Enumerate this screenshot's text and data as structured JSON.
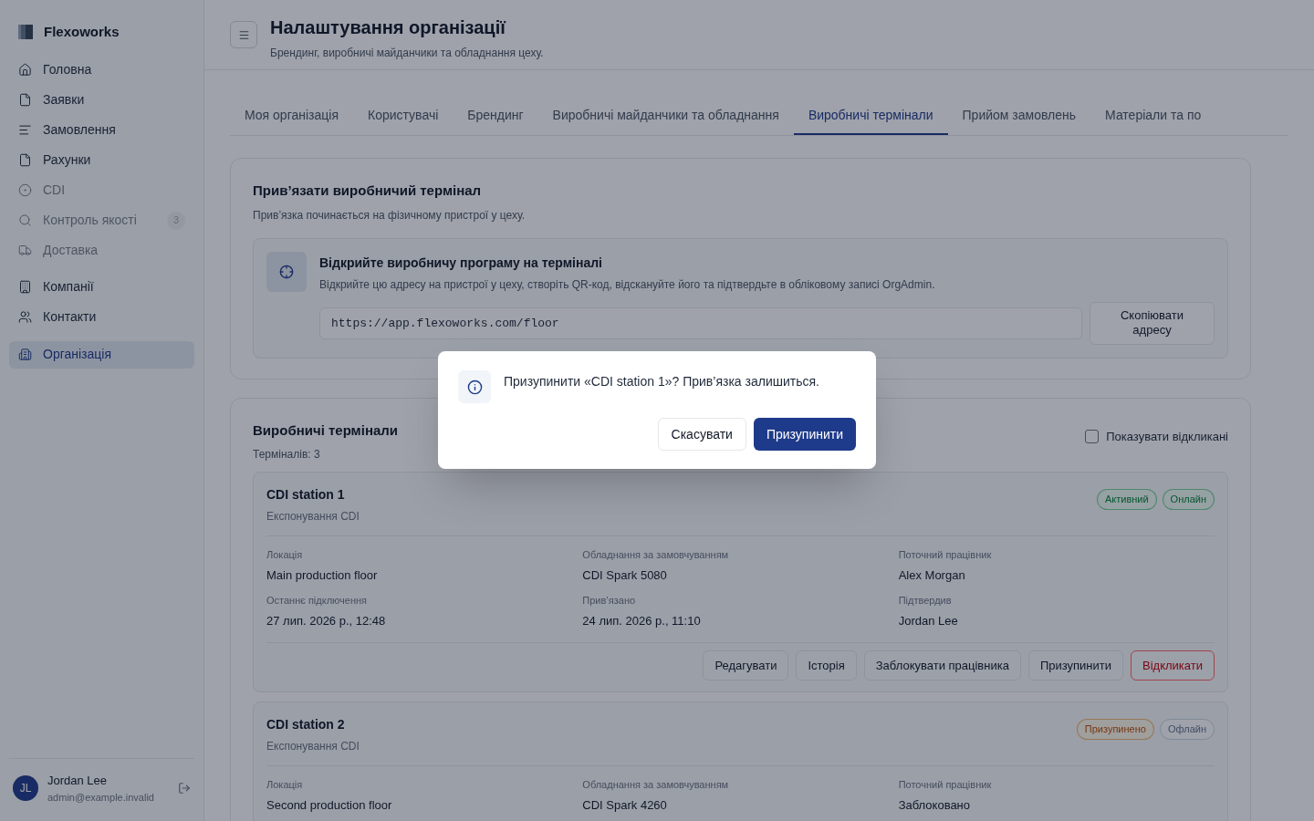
{
  "sidebar": {
    "brand": "Flexoworks",
    "groups": [
      [
        {
          "label": "Головна",
          "muted": false,
          "selected": false
        },
        {
          "label": "Заявки",
          "muted": false,
          "selected": false
        },
        {
          "label": "Замовлення",
          "muted": false,
          "selected": false
        },
        {
          "label": "Рахунки",
          "muted": false,
          "selected": false
        },
        {
          "label": "CDI",
          "muted": true,
          "selected": false
        },
        {
          "label": "Контроль якості",
          "muted": true,
          "selected": false,
          "badge": "3"
        },
        {
          "label": "Доставка",
          "muted": true,
          "selected": false
        }
      ],
      [
        {
          "label": "Компанії",
          "muted": false,
          "selected": false
        },
        {
          "label": "Контакти",
          "muted": false,
          "selected": false
        }
      ],
      [
        {
          "label": "Організація",
          "muted": false,
          "selected": true
        }
      ]
    ],
    "user": {
      "initials": "JL",
      "name": "Jordan Lee",
      "email": "admin@example.invalid"
    }
  },
  "header": {
    "title": "Налаштування організації",
    "subtitle": "Брендинг, виробничі майданчики та обладнання цеху."
  },
  "tabs": [
    {
      "label": "Моя організація",
      "selected": false
    },
    {
      "label": "Користувачі",
      "selected": false
    },
    {
      "label": "Брендинг",
      "selected": false
    },
    {
      "label": "Виробничі майданчики та обладнання",
      "selected": false
    },
    {
      "label": "Виробничі термінали",
      "selected": true
    },
    {
      "label": "Прийом замовлень",
      "selected": false
    },
    {
      "label": "Матеріали та по",
      "selected": false
    }
  ],
  "pairing": {
    "title": "Прив’язати виробничий термінал",
    "subtitle": "Прив’язка починається на фізичному пристрої у цеху.",
    "step_title": "Відкрийте виробничу програму на терміналі",
    "step_text": "Відкрийте цю адресу на пристрої у цеху, створіть QR-код, відскануйте його та підтвердьте в обліковому записі OrgAdmin.",
    "url": "https://app.flexoworks.com/floor",
    "copy_button": "Скопіювати адресу"
  },
  "terminals": {
    "title": "Виробничі термінали",
    "count": "Терміналів: 3",
    "show_revoked": {
      "label": "Показувати відкликані",
      "checked": false
    },
    "items": [
      {
        "name": "CDI station 1",
        "type": "Експонування CDI",
        "badges": [
          {
            "label": "Активний",
            "kind": "success"
          },
          {
            "label": "Онлайн",
            "kind": "success"
          }
        ],
        "fields": [
          {
            "label": "Локація",
            "value": "Main production floor"
          },
          {
            "label": "Обладнання за замовчуванням",
            "value": "CDI Spark 5080"
          },
          {
            "label": "Поточний працівник",
            "value": "Alex Morgan"
          },
          {
            "label": "Останнє підключення",
            "value": "27 лип. 2026 р., 12:48"
          },
          {
            "label": "Прив’язано",
            "value": "24 лип. 2026 р., 11:10"
          },
          {
            "label": "Підтвердив",
            "value": "Jordan Lee"
          }
        ],
        "actions": [
          {
            "label": "Редагувати",
            "kind": "default"
          },
          {
            "label": "Історія",
            "kind": "default"
          },
          {
            "label": "Заблокувати працівника",
            "kind": "default"
          },
          {
            "label": "Призупинити",
            "kind": "default"
          },
          {
            "label": "Відкликати",
            "kind": "danger"
          }
        ]
      },
      {
        "name": "CDI station 2",
        "type": "Експонування CDI",
        "badges": [
          {
            "label": "Призупинено",
            "kind": "warning"
          },
          {
            "label": "Офлайн",
            "kind": "neutral"
          }
        ],
        "fields": [
          {
            "label": "Локація",
            "value": "Second production floor"
          },
          {
            "label": "Обладнання за замовчуванням",
            "value": "CDI Spark 4260"
          },
          {
            "label": "Поточний працівник",
            "value": "Заблоковано"
          }
        ]
      }
    ]
  },
  "dialog": {
    "message": "Призупинити «CDI station 1»? Прив’язка залишиться.",
    "buttons": [
      {
        "label": "Скасувати",
        "kind": "secondary"
      },
      {
        "label": "Призупинити",
        "kind": "primary"
      }
    ]
  }
}
